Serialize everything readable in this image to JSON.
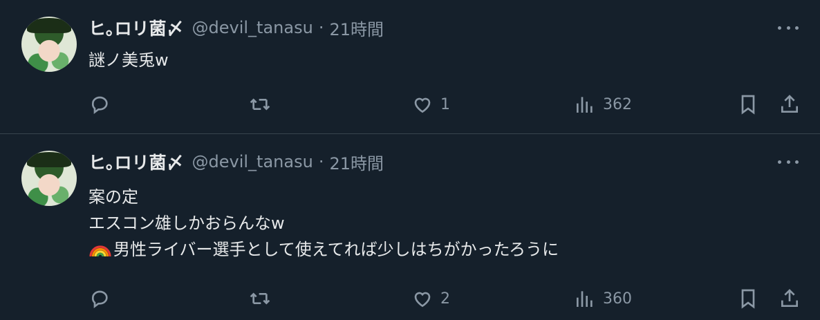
{
  "tweets": [
    {
      "display_name": "ヒ｡ロリ菌〆",
      "handle": "@devil_tanasu",
      "separator": "·",
      "time": "21時間",
      "lines": [
        "謎ノ美兎w"
      ],
      "replies": "",
      "retweets": "",
      "likes": "1",
      "views": "362"
    },
    {
      "display_name": "ヒ｡ロリ菌〆",
      "handle": "@devil_tanasu",
      "separator": "·",
      "time": "21時間",
      "lines": [
        "案の定",
        "エスコン雄しかおらんなw",
        "男性ライバー選手として使えてれば少しはちがかったろうに"
      ],
      "replies": "",
      "retweets": "",
      "likes": "2",
      "views": "360"
    }
  ],
  "icons": {
    "reply": "reply-icon",
    "retweet": "retweet-icon",
    "like": "heart-icon",
    "views": "views-icon",
    "bookmark": "bookmark-icon",
    "share": "share-icon",
    "more": "more-icon",
    "rainbow": "rainbow-emoji"
  },
  "colors": {
    "background": "#15202b",
    "text": "#e7e9ea",
    "muted": "#8b98a5",
    "divider": "#38444d"
  }
}
